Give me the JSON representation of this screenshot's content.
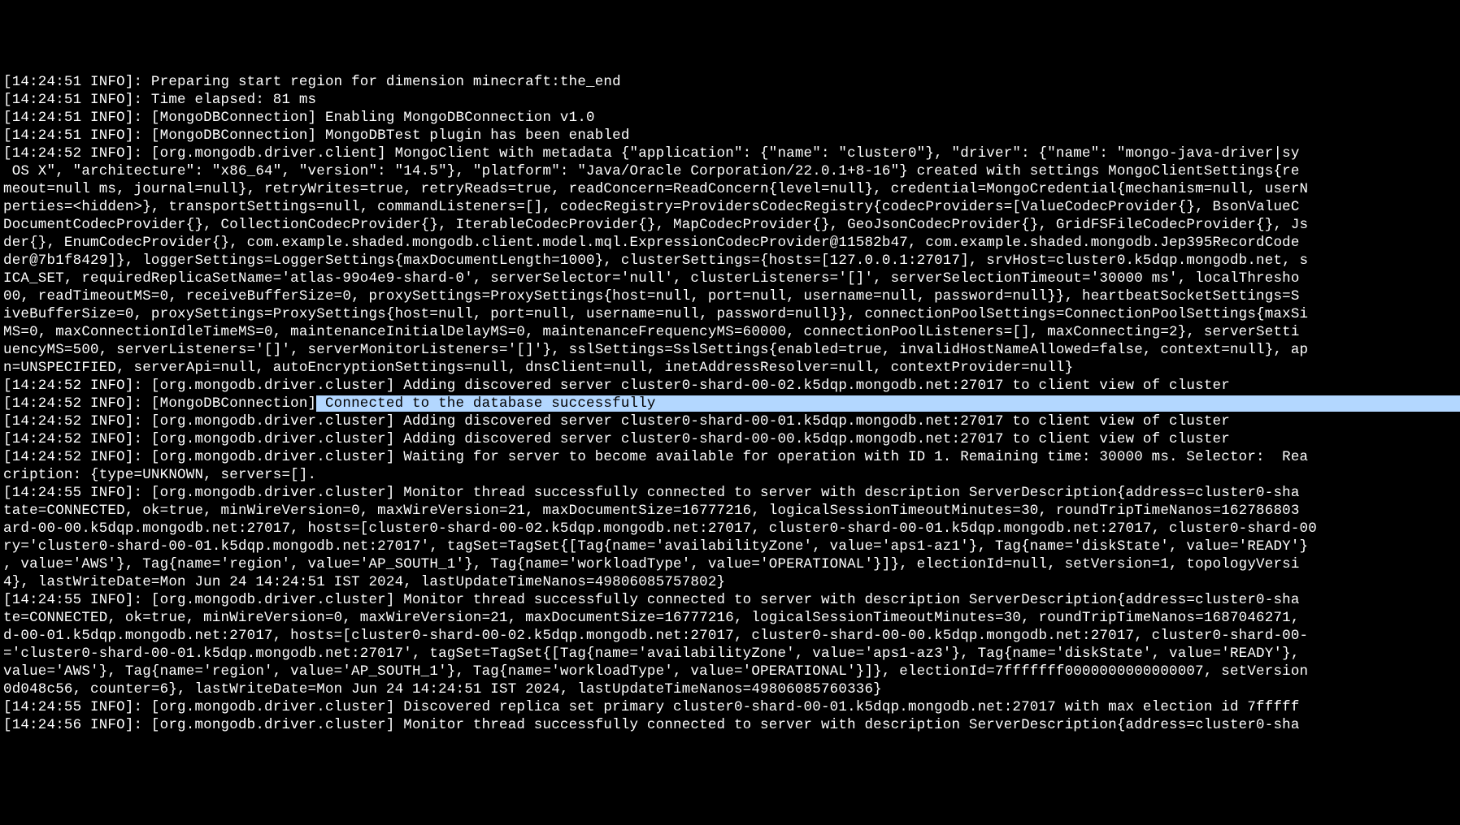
{
  "log_lines": [
    {
      "ts": "[14:24:51 INFO]: ",
      "text": "Preparing start region for dimension minecraft:the_end"
    },
    {
      "ts": "[14:24:51 INFO]: ",
      "text": "Time elapsed: 81 ms"
    },
    {
      "ts": "[14:24:51 INFO]: ",
      "text": "[MongoDBConnection] Enabling MongoDBConnection v1.0"
    },
    {
      "ts": "[14:24:51 INFO]: ",
      "text": "[MongoDBConnection] MongoDBTest plugin has been enabled"
    },
    {
      "ts": "[14:24:52 INFO]: ",
      "text": "[org.mongodb.driver.client] MongoClient with metadata {\"application\": {\"name\": \"cluster0\"}, \"driver\": {\"name\": \"mongo-java-driver|sy"
    },
    {
      "ts": "",
      "text": " OS X\", \"architecture\": \"x86_64\", \"version\": \"14.5\"}, \"platform\": \"Java/Oracle Corporation/22.0.1+8-16\"} created with settings MongoClientSettings{re"
    },
    {
      "ts": "",
      "text": "meout=null ms, journal=null}, retryWrites=true, retryReads=true, readConcern=ReadConcern{level=null}, credential=MongoCredential{mechanism=null, userN"
    },
    {
      "ts": "",
      "text": "perties=<hidden>}, transportSettings=null, commandListeners=[], codecRegistry=ProvidersCodecRegistry{codecProviders=[ValueCodecProvider{}, BsonValueC"
    },
    {
      "ts": "",
      "text": "DocumentCodecProvider{}, CollectionCodecProvider{}, IterableCodecProvider{}, MapCodecProvider{}, GeoJsonCodecProvider{}, GridFSFileCodecProvider{}, Js"
    },
    {
      "ts": "",
      "text": "der{}, EnumCodecProvider{}, com.example.shaded.mongodb.client.model.mql.ExpressionCodecProvider@11582b47, com.example.shaded.mongodb.Jep395RecordCode"
    },
    {
      "ts": "",
      "text": "der@7b1f8429]}, loggerSettings=LoggerSettings{maxDocumentLength=1000}, clusterSettings={hosts=[127.0.0.1:27017], srvHost=cluster0.k5dqp.mongodb.net, s"
    },
    {
      "ts": "",
      "text": "ICA_SET, requiredReplicaSetName='atlas-99o4e9-shard-0', serverSelector='null', clusterListeners='[]', serverSelectionTimeout='30000 ms', localThresho"
    },
    {
      "ts": "",
      "text": "00, readTimeoutMS=0, receiveBufferSize=0, proxySettings=ProxySettings{host=null, port=null, username=null, password=null}}, heartbeatSocketSettings=S"
    },
    {
      "ts": "",
      "text": "iveBufferSize=0, proxySettings=ProxySettings{host=null, port=null, username=null, password=null}}, connectionPoolSettings=ConnectionPoolSettings{maxSi"
    },
    {
      "ts": "",
      "text": "MS=0, maxConnectionIdleTimeMS=0, maintenanceInitialDelayMS=0, maintenanceFrequencyMS=60000, connectionPoolListeners=[], maxConnecting=2}, serverSetti"
    },
    {
      "ts": "",
      "text": "uencyMS=500, serverListeners='[]', serverMonitorListeners='[]'}, sslSettings=SslSettings{enabled=true, invalidHostNameAllowed=false, context=null}, ap"
    },
    {
      "ts": "",
      "text": "n=UNSPECIFIED, serverApi=null, autoEncryptionSettings=null, dnsClient=null, inetAddressResolver=null, contextProvider=null}"
    },
    {
      "ts": "[14:24:52 INFO]: ",
      "text": "[org.mongodb.driver.cluster] Adding discovered server cluster0-shard-00-02.k5dqp.mongodb.net:27017 to client view of cluster"
    },
    {
      "ts": "[14:24:52 INFO]: ",
      "prefix": "[MongoDBConnection]",
      "highlight": " Connected to the database successfully",
      "highlight_after": "                                                                                                                      "
    },
    {
      "ts": "[14:24:52 INFO]: ",
      "text": "[org.mongodb.driver.cluster] Adding discovered server cluster0-shard-00-01.k5dqp.mongodb.net:27017 to client view of cluster"
    },
    {
      "ts": "[14:24:52 INFO]: ",
      "text": "[org.mongodb.driver.cluster] Adding discovered server cluster0-shard-00-00.k5dqp.mongodb.net:27017 to client view of cluster"
    },
    {
      "ts": "[14:24:52 INFO]: ",
      "text": "[org.mongodb.driver.cluster] Waiting for server to become available for operation with ID 1. Remaining time: 30000 ms. Selector:  Rea"
    },
    {
      "ts": "",
      "text": "cription: {type=UNKNOWN, servers=[]."
    },
    {
      "ts": "[14:24:55 INFO]: ",
      "text": "[org.mongodb.driver.cluster] Monitor thread successfully connected to server with description ServerDescription{address=cluster0-sha"
    },
    {
      "ts": "",
      "text": "tate=CONNECTED, ok=true, minWireVersion=0, maxWireVersion=21, maxDocumentSize=16777216, logicalSessionTimeoutMinutes=30, roundTripTimeNanos=162786803"
    },
    {
      "ts": "",
      "text": "ard-00-00.k5dqp.mongodb.net:27017, hosts=[cluster0-shard-00-02.k5dqp.mongodb.net:27017, cluster0-shard-00-01.k5dqp.mongodb.net:27017, cluster0-shard-00"
    },
    {
      "ts": "",
      "text": "ry='cluster0-shard-00-01.k5dqp.mongodb.net:27017', tagSet=TagSet{[Tag{name='availabilityZone', value='aps1-az1'}, Tag{name='diskState', value='READY'}"
    },
    {
      "ts": "",
      "text": ", value='AWS'}, Tag{name='region', value='AP_SOUTH_1'}, Tag{name='workloadType', value='OPERATIONAL'}]}, electionId=null, setVersion=1, topologyVersi"
    },
    {
      "ts": "",
      "text": "4}, lastWriteDate=Mon Jun 24 14:24:51 IST 2024, lastUpdateTimeNanos=49806085757802}"
    },
    {
      "ts": "[14:24:55 INFO]: ",
      "text": "[org.mongodb.driver.cluster] Monitor thread successfully connected to server with description ServerDescription{address=cluster0-sha"
    },
    {
      "ts": "",
      "text": "te=CONNECTED, ok=true, minWireVersion=0, maxWireVersion=21, maxDocumentSize=16777216, logicalSessionTimeoutMinutes=30, roundTripTimeNanos=1687046271, "
    },
    {
      "ts": "",
      "text": "d-00-01.k5dqp.mongodb.net:27017, hosts=[cluster0-shard-00-02.k5dqp.mongodb.net:27017, cluster0-shard-00-00.k5dqp.mongodb.net:27017, cluster0-shard-00-"
    },
    {
      "ts": "",
      "text": "='cluster0-shard-00-01.k5dqp.mongodb.net:27017', tagSet=TagSet{[Tag{name='availabilityZone', value='aps1-az3'}, Tag{name='diskState', value='READY'}, "
    },
    {
      "ts": "",
      "text": "value='AWS'}, Tag{name='region', value='AP_SOUTH_1'}, Tag{name='workloadType', value='OPERATIONAL'}]}, electionId=7fffffff0000000000000007, setVersion"
    },
    {
      "ts": "",
      "text": "0d048c56, counter=6}, lastWriteDate=Mon Jun 24 14:24:51 IST 2024, lastUpdateTimeNanos=49806085760336}"
    },
    {
      "ts": "[14:24:55 INFO]: ",
      "text": "[org.mongodb.driver.cluster] Discovered replica set primary cluster0-shard-00-01.k5dqp.mongodb.net:27017 with max election id 7fffff"
    },
    {
      "ts": "[14:24:56 INFO]: ",
      "text": "[org.mongodb.driver.cluster] Monitor thread successfully connected to server with description ServerDescription{address=cluster0-sha"
    }
  ]
}
